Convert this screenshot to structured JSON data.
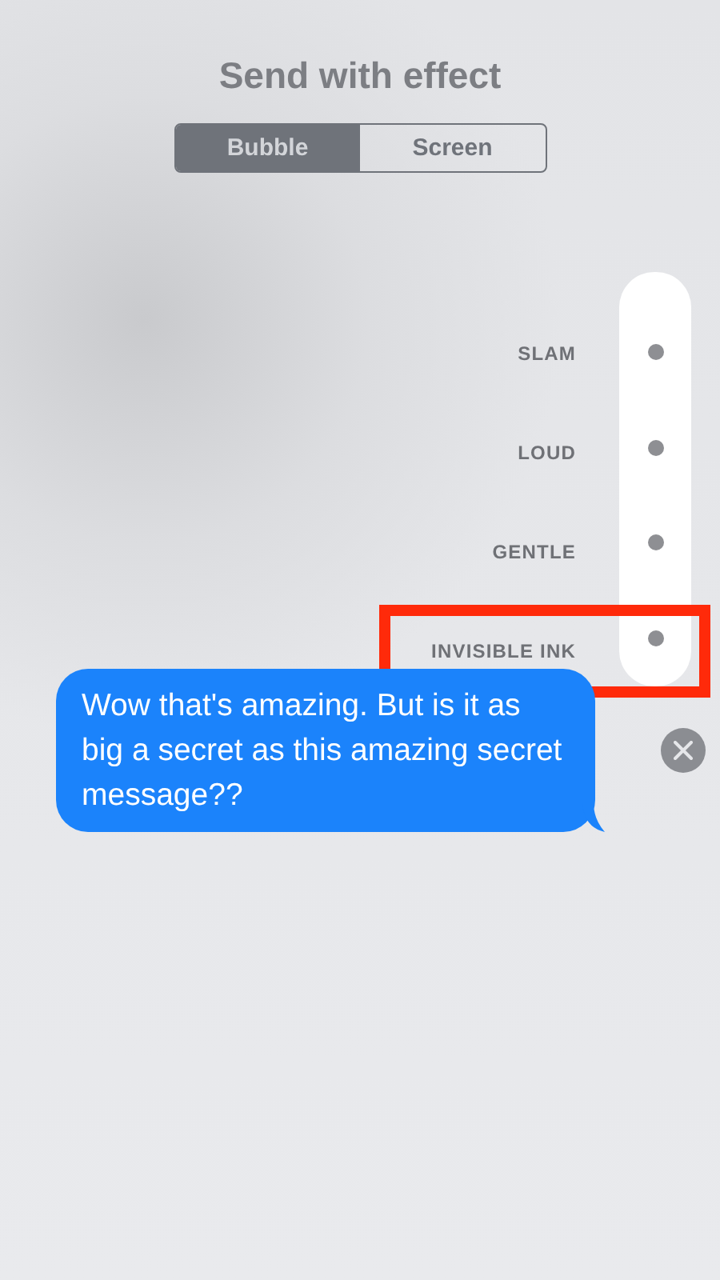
{
  "title": "Send with effect",
  "tabs": [
    {
      "label": "Bubble",
      "selected": true
    },
    {
      "label": "Screen",
      "selected": false
    }
  ],
  "effects": [
    {
      "label": "SLAM",
      "highlighted": false
    },
    {
      "label": "LOUD",
      "highlighted": false
    },
    {
      "label": "GENTLE",
      "highlighted": false
    },
    {
      "label": "INVISIBLE INK",
      "highlighted": true
    }
  ],
  "message": {
    "text": "Wow that's amazing. But is it as big a secret as this amazing secret message??"
  }
}
